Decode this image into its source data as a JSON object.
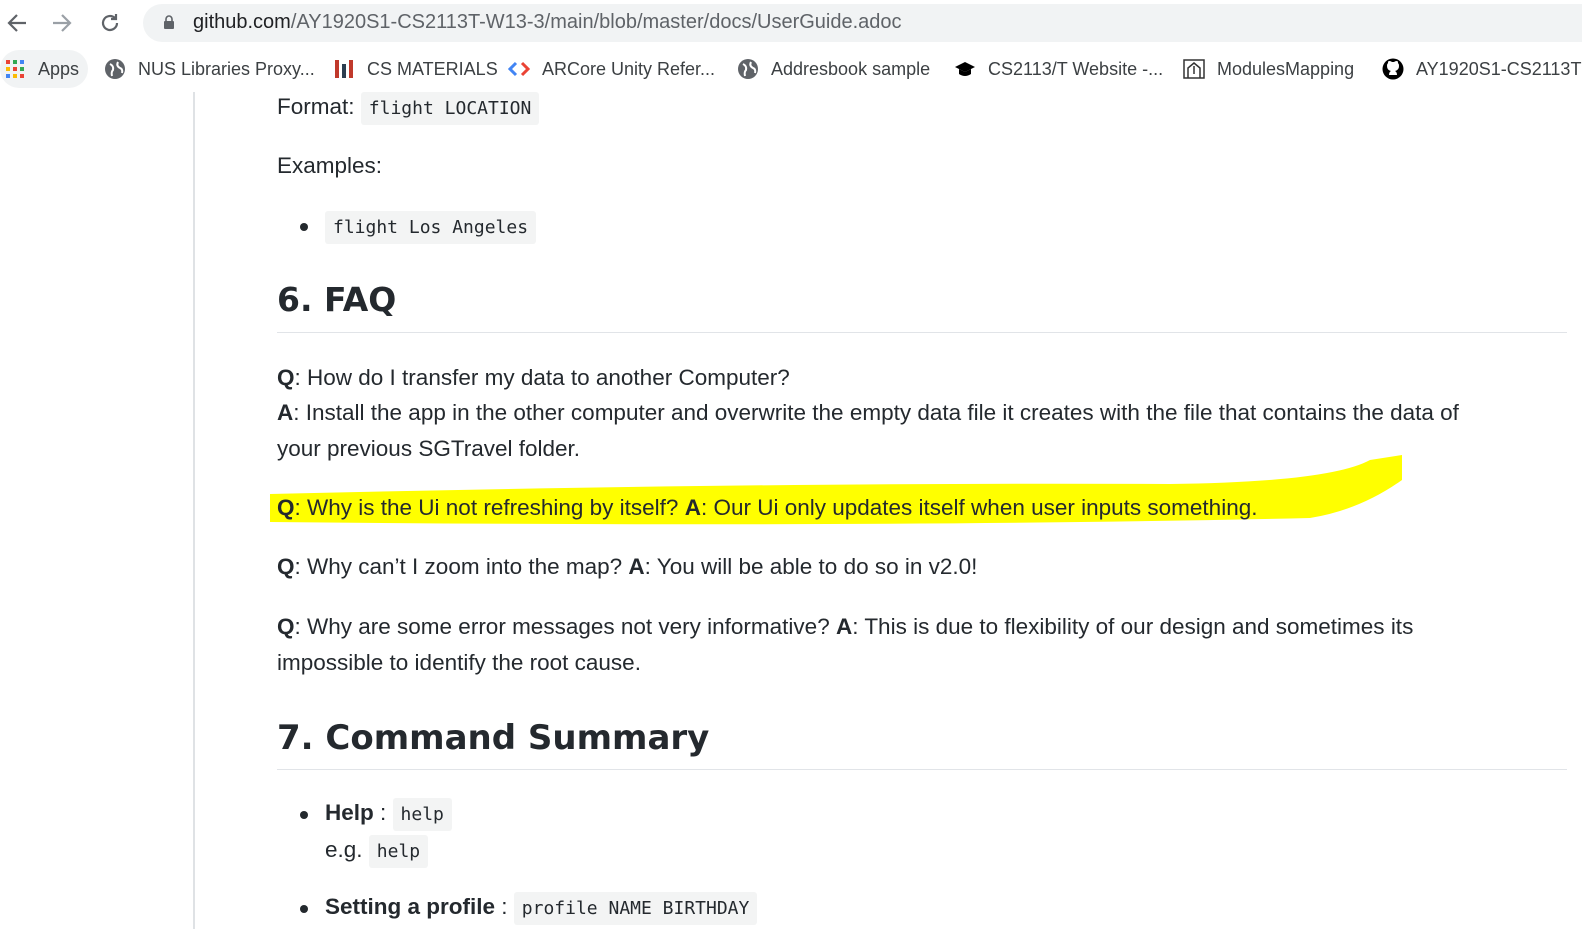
{
  "browser": {
    "url_domain": "github.com",
    "url_path": "/AY1920S1-CS2113T-W13-3/main/blob/master/docs/UserGuide.adoc"
  },
  "bookmarks": [
    {
      "label": "Apps",
      "icon": "apps-grid-icon"
    },
    {
      "label": "NUS Libraries Proxy...",
      "icon": "globe-icon"
    },
    {
      "label": "CS MATERIALS",
      "icon": "bars-icon"
    },
    {
      "label": "ARCore Unity Refer...",
      "icon": "code-arrows-icon"
    },
    {
      "label": "Addresbook sample",
      "icon": "globe-icon"
    },
    {
      "label": "CS2113/T Website -...",
      "icon": "graduation-cap-icon"
    },
    {
      "label": "ModulesMapping",
      "icon": "arch-icon"
    },
    {
      "label": "AY1920S1-CS2113T",
      "icon": "github-icon"
    }
  ],
  "doc": {
    "format_label": "Format:",
    "format_code": "flight LOCATION",
    "examples_label": "Examples:",
    "example_code": "flight Los Angeles",
    "faq_heading": "6. FAQ",
    "faq": [
      {
        "q": "Q",
        "q_text": ": How do I transfer my data to another Computer?",
        "a": "A",
        "a_text": ": Install the app in the other computer and overwrite the empty data file it creates with the file that contains the data of",
        "a_text2": "your previous SGTravel folder."
      },
      {
        "q": "Q",
        "q_text": ": Why is the Ui not refreshing by itself? ",
        "a": "A",
        "a_text": ": Our Ui only updates itself when user inputs something."
      },
      {
        "q": "Q",
        "q_text": ": Why can’t I zoom into the map? ",
        "a": "A",
        "a_text": ": You will be able to do so in v2.0!"
      },
      {
        "q": "Q",
        "q_text": ": Why are some error messages not very informative? ",
        "a": "A",
        "a_text": ": This is due to flexibility of our design and sometimes its",
        "a_text2": "impossible to identify the root cause."
      }
    ],
    "summary_heading": "7. Command Summary",
    "summary": [
      {
        "label": "Help",
        "sep": " : ",
        "code": "help",
        "eg_label": "e.g.",
        "eg_code": "help"
      },
      {
        "label": "Setting a profile",
        "sep": " : ",
        "code": "profile NAME BIRTHDAY"
      }
    ]
  },
  "colors": {
    "highlight": "#ffff00",
    "text": "#24292e"
  }
}
